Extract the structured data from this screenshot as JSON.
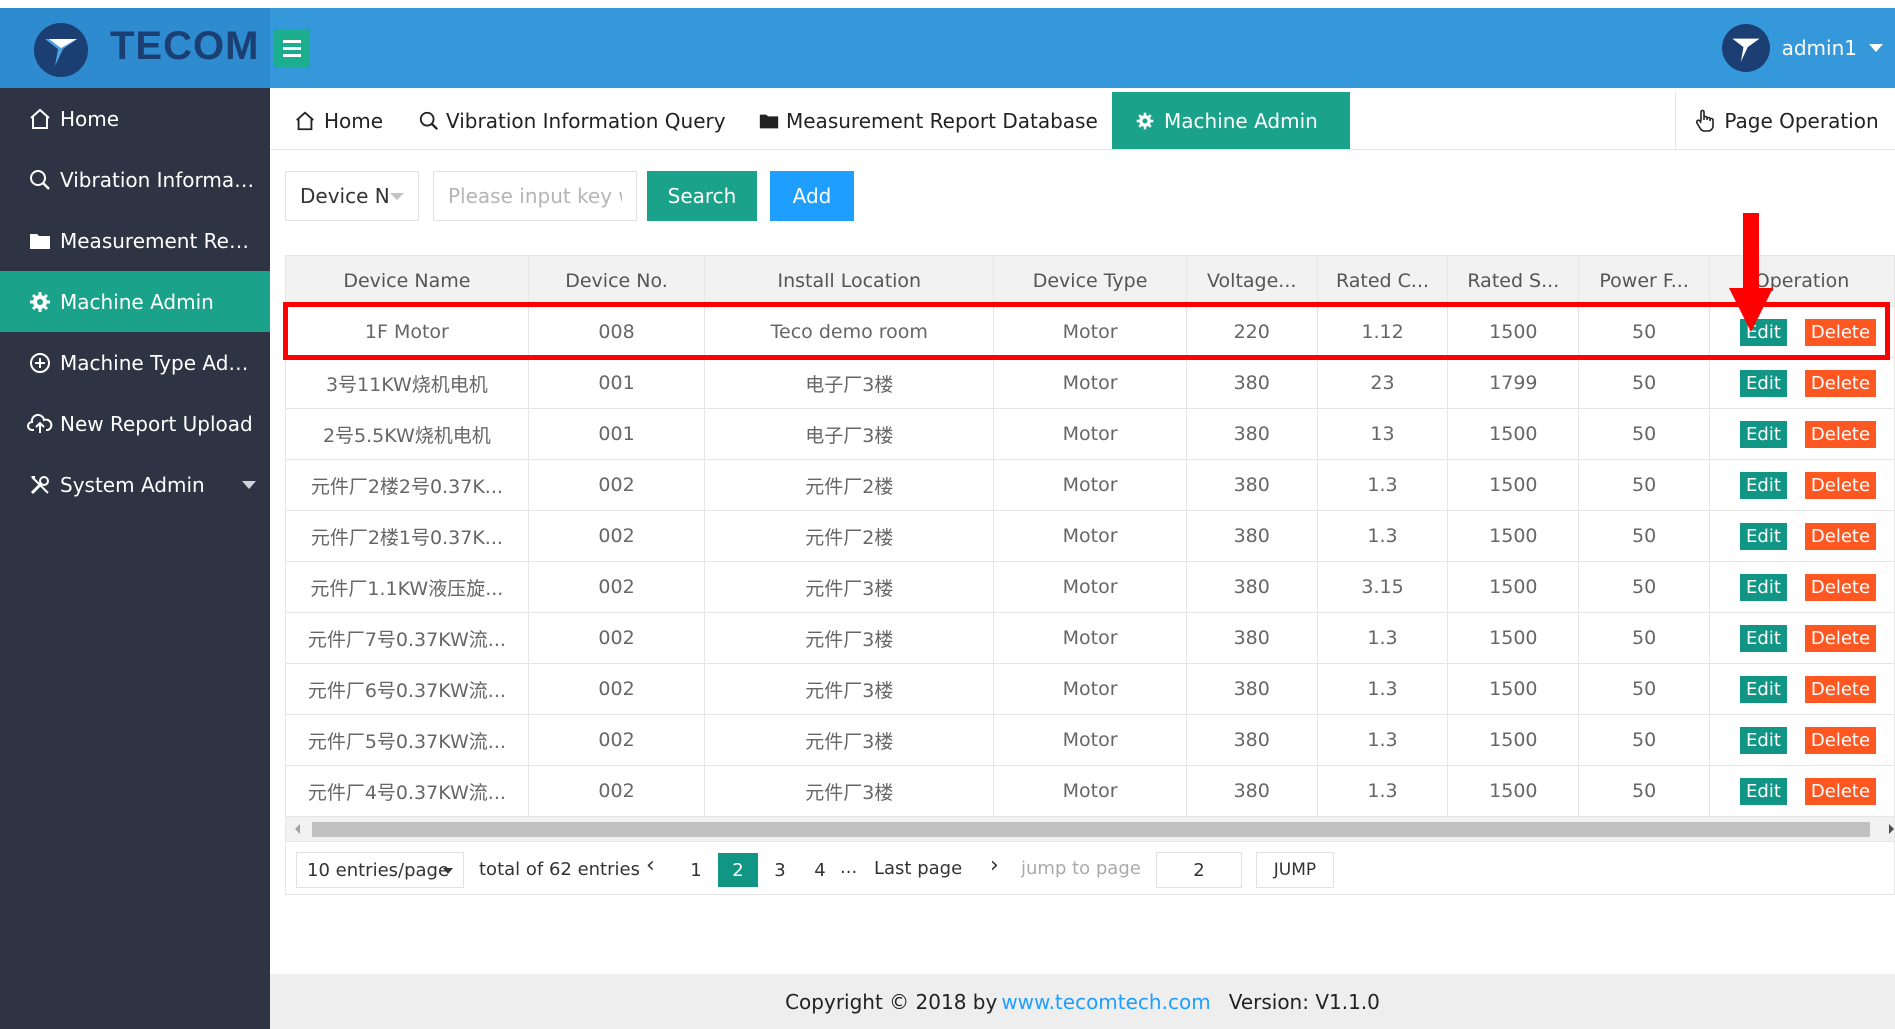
{
  "app": {
    "logo_text": "TECOM",
    "username": "admin1"
  },
  "sidebar": {
    "items": [
      {
        "label": "Home",
        "icon": "home-icon"
      },
      {
        "label": "Vibration Informatio...",
        "icon": "search-icon"
      },
      {
        "label": "Measurement Rep...",
        "icon": "folder-icon"
      },
      {
        "label": "Machine Admin",
        "icon": "gear-icon",
        "active": true
      },
      {
        "label": "Machine Type Adm...",
        "icon": "plus-circle-icon"
      },
      {
        "label": "New Report Upload",
        "icon": "cloud-upload-icon"
      },
      {
        "label": "System Admin",
        "icon": "tools-icon"
      }
    ]
  },
  "tabs": {
    "items": [
      {
        "label": "Home"
      },
      {
        "label": "Vibration Information Query"
      },
      {
        "label": "Measurement Report Database"
      },
      {
        "label": "Machine Admin"
      }
    ],
    "page_operation": "Page Operation"
  },
  "toolbar": {
    "select_value": "Device N",
    "search_placeholder": "Please input key word",
    "search_label": "Search",
    "add_label": "Add"
  },
  "table": {
    "columns": [
      "Device Name",
      "Device No.",
      "Install Location",
      "Device Type",
      "Voltage...",
      "Rated C...",
      "Rated S...",
      "Power F...",
      "Operation"
    ],
    "edit_label": "Edit",
    "delete_label": "Delete",
    "rows": [
      [
        "1F Motor",
        "008",
        "Teco demo room",
        "Motor",
        "220",
        "1.12",
        "1500",
        "50"
      ],
      [
        "3号11KW烧机电机",
        "001",
        "电子厂3楼",
        "Motor",
        "380",
        "23",
        "1799",
        "50"
      ],
      [
        "2号5.5KW烧机电机",
        "001",
        "电子厂3楼",
        "Motor",
        "380",
        "13",
        "1500",
        "50"
      ],
      [
        "元件厂2楼2号0.37K...",
        "002",
        "元件厂2楼",
        "Motor",
        "380",
        "1.3",
        "1500",
        "50"
      ],
      [
        "元件厂2楼1号0.37K...",
        "002",
        "元件厂2楼",
        "Motor",
        "380",
        "1.3",
        "1500",
        "50"
      ],
      [
        "元件厂1.1KW液压旋...",
        "002",
        "元件厂3楼",
        "Motor",
        "380",
        "3.15",
        "1500",
        "50"
      ],
      [
        "元件厂7号0.37KW流...",
        "002",
        "元件厂3楼",
        "Motor",
        "380",
        "1.3",
        "1500",
        "50"
      ],
      [
        "元件厂6号0.37KW流...",
        "002",
        "元件厂3楼",
        "Motor",
        "380",
        "1.3",
        "1500",
        "50"
      ],
      [
        "元件厂5号0.37KW流...",
        "002",
        "元件厂3楼",
        "Motor",
        "380",
        "1.3",
        "1500",
        "50"
      ],
      [
        "元件厂4号0.37KW流...",
        "002",
        "元件厂3楼",
        "Motor",
        "380",
        "1.3",
        "1500",
        "50"
      ]
    ]
  },
  "pager": {
    "per_page": "10 entries/page",
    "total": "total of 62 entries",
    "prev": "‹",
    "next": "›",
    "pages": [
      "1",
      "2",
      "3",
      "4"
    ],
    "current_page": "2",
    "dots": "...",
    "last": "Last page",
    "jump_label": "jump to page",
    "jump_value": "2",
    "jump_button": "JUMP"
  },
  "footer": {
    "prefix": "Copyright © 2018 by",
    "link": "www.tecomtech.com",
    "version": "Version: V1.1.0"
  },
  "colors": {
    "header": "#3498db",
    "sidebar": "#2e3443",
    "accent": "#1aa38a",
    "add_button": "#1e9fff",
    "delete_button": "#ff5722",
    "annotation": "#ff0000"
  }
}
